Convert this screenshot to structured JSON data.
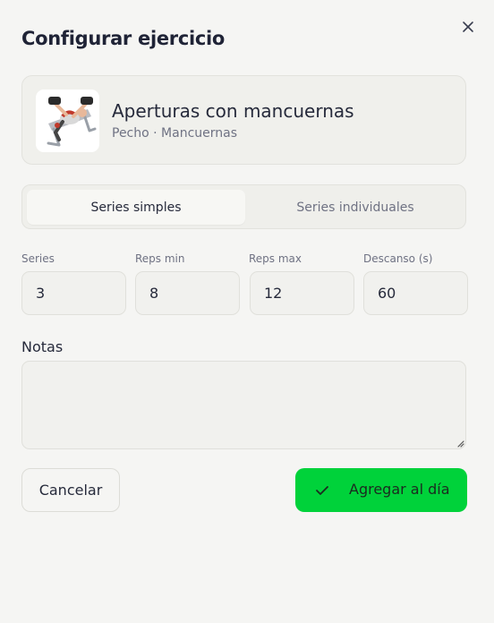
{
  "dialog": {
    "title": "Configurar ejercicio",
    "close_icon": "close-icon"
  },
  "exercise": {
    "name": "Aperturas con mancuernas",
    "meta": "Pecho · Mancuernas",
    "thumbnail": "exercise-illustration"
  },
  "tabs": [
    {
      "label": "Series simples",
      "active": true
    },
    {
      "label": "Series individuales",
      "active": false
    }
  ],
  "fields": [
    {
      "label": "Series",
      "value": "3"
    },
    {
      "label": "Reps min",
      "value": "8"
    },
    {
      "label": "Reps max",
      "value": "12"
    },
    {
      "label": "Descanso (s)",
      "value": "60"
    }
  ],
  "notes": {
    "label": "Notas",
    "value": ""
  },
  "actions": {
    "cancel_label": "Cancelar",
    "add_label": "Agregar al día",
    "add_icon": "check-icon",
    "accent": "#00d23a"
  }
}
